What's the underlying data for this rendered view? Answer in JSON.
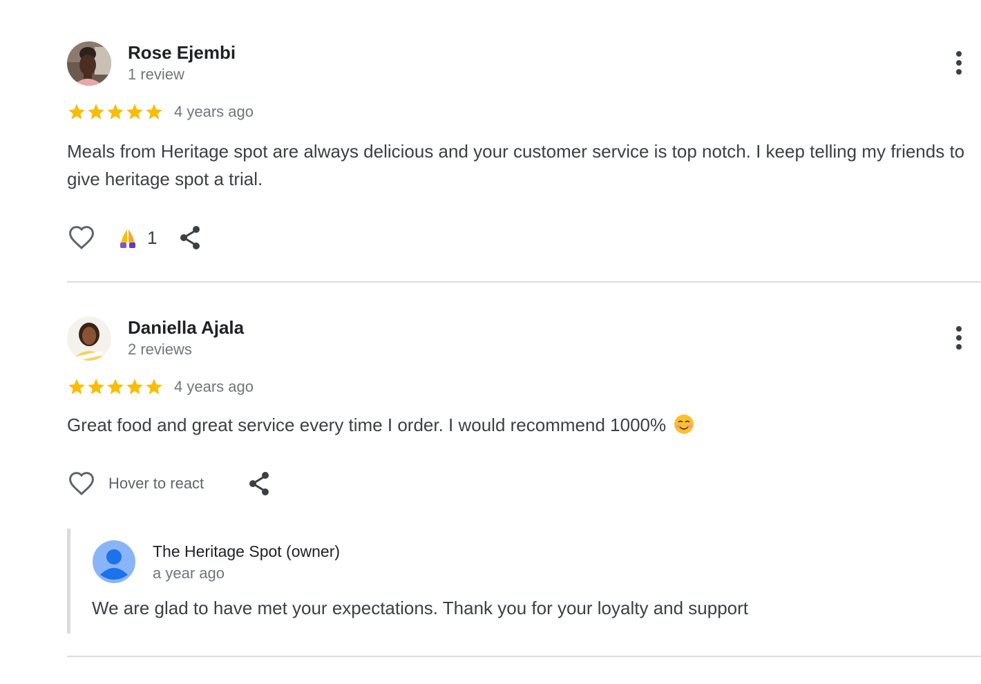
{
  "reviews": [
    {
      "author": "Rose Ejembi",
      "review_count": "1 review",
      "rating": 5,
      "date": "4 years ago",
      "text": "Meals from Heritage spot are always delicious and your customer service is top notch. I keep telling my friends to give heritage spot a trial.",
      "reaction_count": "1"
    },
    {
      "author": "Daniella Ajala",
      "review_count": "2 reviews",
      "rating": 5,
      "date": "4 years ago",
      "text": "Great food and great service every time I order. I would recommend 1000%",
      "hover_label": "Hover to react",
      "owner_reply": {
        "name": "The Heritage Spot (owner)",
        "date": "a year ago",
        "text": "We are glad to have met your expectations. Thank you for your loyalty and support"
      }
    }
  ],
  "colors": {
    "star": "#fbbc04",
    "divider": "#dadce0",
    "icon": "#5f6368"
  },
  "icons": [
    "more-vert-icon",
    "heart-outline-icon",
    "praying-hands-emoji",
    "share-icon",
    "smiling-face-emoji",
    "default-user-avatar"
  ]
}
